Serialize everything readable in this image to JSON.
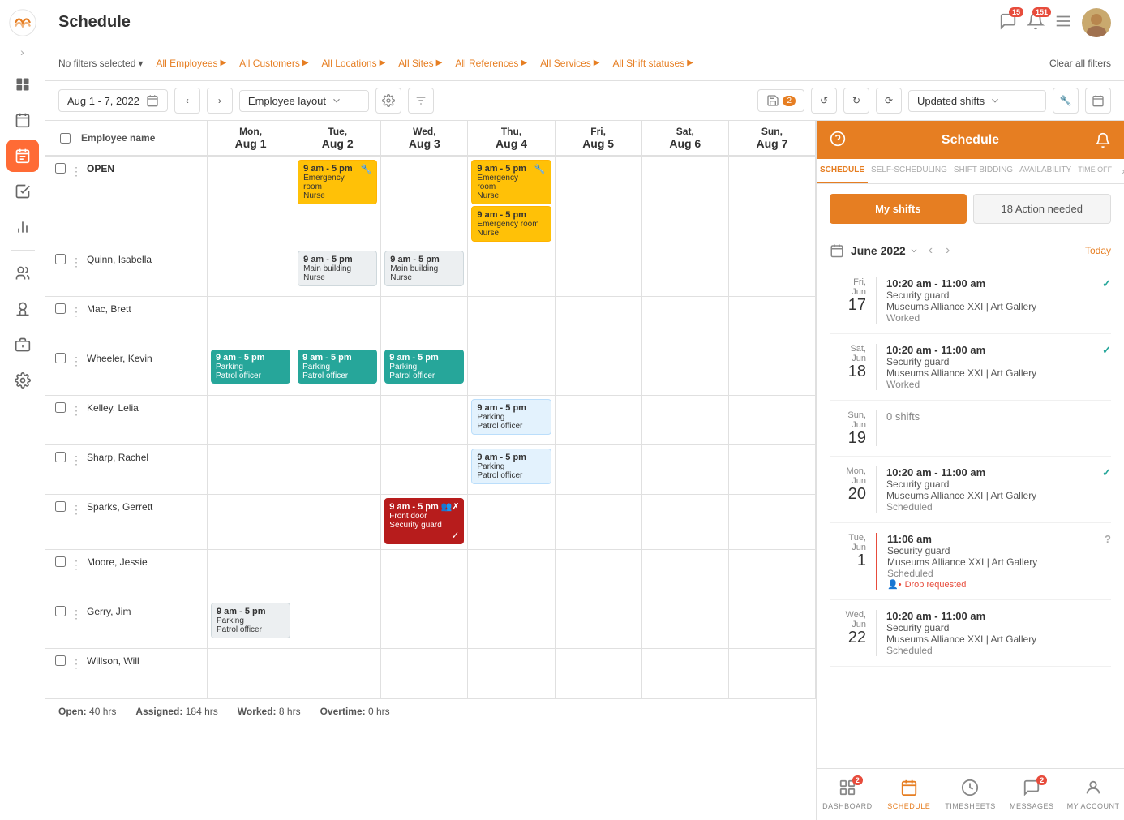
{
  "app": {
    "title": "Schedule",
    "logo_alt": "App Logo"
  },
  "topbar": {
    "notifications_count": "15",
    "alerts_count": "151",
    "menu_label": "Menu"
  },
  "filters": {
    "no_filters": "No filters selected",
    "employees": "All Employees",
    "customers": "All Customers",
    "locations": "All Locations",
    "sites": "All Sites",
    "references": "All References",
    "services": "All Services",
    "shift_statuses": "All Shift statuses",
    "clear": "Clear all filters"
  },
  "toolbar": {
    "date_range": "Aug 1 - 7, 2022",
    "layout": "Employee layout",
    "save_label": "2",
    "updated_shifts": "Updated shifts"
  },
  "calendar": {
    "columns": [
      {
        "day": "Mon",
        "date": "Aug 1"
      },
      {
        "day": "Tue",
        "date": "Aug 2"
      },
      {
        "day": "Wed",
        "date": "Aug 3"
      },
      {
        "day": "Thu",
        "date": "Aug 4"
      },
      {
        "day": "Fri",
        "date": "Aug 5"
      },
      {
        "day": "Sat",
        "date": "Aug 6"
      },
      {
        "day": "Sun",
        "date": "Aug 7"
      }
    ],
    "employee_col_header": "Employee name",
    "rows": [
      {
        "name": "OPEN",
        "is_open": true,
        "cells": [
          {
            "day": 0,
            "shifts": []
          },
          {
            "day": 1,
            "shifts": [
              {
                "time": "9 am - 5 pm",
                "location": "Emergency room",
                "role": "Nurse",
                "style": "yellow",
                "icon": "🔧"
              }
            ]
          },
          {
            "day": 2,
            "shifts": []
          },
          {
            "day": 3,
            "shifts": [
              {
                "time": "9 am - 5 pm",
                "location": "Emergency room",
                "role": "Nurse",
                "style": "yellow",
                "icon": "🔧"
              },
              {
                "time": "9 am - 5 pm",
                "location": "Emergency room",
                "role": "Nurse",
                "style": "yellow"
              }
            ]
          },
          {
            "day": 4,
            "shifts": []
          },
          {
            "day": 5,
            "shifts": []
          },
          {
            "day": 6,
            "shifts": []
          }
        ]
      },
      {
        "name": "Quinn, Isabella",
        "cells": [
          {
            "day": 0,
            "shifts": []
          },
          {
            "day": 1,
            "shifts": [
              {
                "time": "9 am - 5 pm",
                "location": "Main building",
                "role": "Nurse",
                "style": "gray"
              }
            ]
          },
          {
            "day": 2,
            "shifts": [
              {
                "time": "9 am - 5 pm",
                "location": "Main building",
                "role": "Nurse",
                "style": "gray"
              }
            ]
          },
          {
            "day": 3,
            "shifts": []
          },
          {
            "day": 4,
            "shifts": []
          },
          {
            "day": 5,
            "shifts": []
          },
          {
            "day": 6,
            "shifts": []
          }
        ]
      },
      {
        "name": "Mac, Brett",
        "cells": [
          {
            "day": 0,
            "shifts": []
          },
          {
            "day": 1,
            "shifts": []
          },
          {
            "day": 2,
            "shifts": []
          },
          {
            "day": 3,
            "shifts": []
          },
          {
            "day": 4,
            "shifts": []
          },
          {
            "day": 5,
            "shifts": []
          },
          {
            "day": 6,
            "shifts": []
          }
        ]
      },
      {
        "name": "Wheeler, Kevin",
        "cells": [
          {
            "day": 0,
            "shifts": [
              {
                "time": "9 am - 5 pm",
                "location": "Parking",
                "role": "Patrol officer",
                "style": "teal"
              }
            ]
          },
          {
            "day": 1,
            "shifts": [
              {
                "time": "9 am - 5 pm",
                "location": "Parking",
                "role": "Patrol officer",
                "style": "teal"
              }
            ]
          },
          {
            "day": 2,
            "shifts": [
              {
                "time": "9 am - 5 pm",
                "location": "Parking",
                "role": "Patrol officer",
                "style": "teal"
              }
            ]
          },
          {
            "day": 3,
            "shifts": []
          },
          {
            "day": 4,
            "shifts": []
          },
          {
            "day": 5,
            "shifts": []
          },
          {
            "day": 6,
            "shifts": []
          }
        ]
      },
      {
        "name": "Kelley, Lelia",
        "cells": [
          {
            "day": 0,
            "shifts": []
          },
          {
            "day": 1,
            "shifts": []
          },
          {
            "day": 2,
            "shifts": []
          },
          {
            "day": 3,
            "shifts": [
              {
                "time": "9 am - 5 pm",
                "location": "Parking",
                "role": "Patrol officer",
                "style": "blue-light"
              }
            ]
          },
          {
            "day": 4,
            "shifts": []
          },
          {
            "day": 5,
            "shifts": []
          },
          {
            "day": 6,
            "shifts": []
          }
        ]
      },
      {
        "name": "Sharp, Rachel",
        "cells": [
          {
            "day": 0,
            "shifts": []
          },
          {
            "day": 1,
            "shifts": []
          },
          {
            "day": 2,
            "shifts": []
          },
          {
            "day": 3,
            "shifts": [
              {
                "time": "9 am - 5 pm",
                "location": "Parking",
                "role": "Patrol officer",
                "style": "blue-light"
              }
            ]
          },
          {
            "day": 4,
            "shifts": []
          },
          {
            "day": 5,
            "shifts": []
          },
          {
            "day": 6,
            "shifts": []
          }
        ]
      },
      {
        "name": "Sparks, Gerrett",
        "cells": [
          {
            "day": 0,
            "shifts": []
          },
          {
            "day": 1,
            "shifts": []
          },
          {
            "day": 2,
            "shifts": [
              {
                "time": "9 am - 5 pm",
                "location": "Front door",
                "role": "Security guard",
                "style": "red",
                "icon": "👥✗",
                "check": true
              }
            ]
          },
          {
            "day": 3,
            "shifts": []
          },
          {
            "day": 4,
            "shifts": []
          },
          {
            "day": 5,
            "shifts": []
          },
          {
            "day": 6,
            "shifts": []
          }
        ]
      },
      {
        "name": "Moore, Jessie",
        "cells": [
          {
            "day": 0,
            "shifts": []
          },
          {
            "day": 1,
            "shifts": []
          },
          {
            "day": 2,
            "shifts": []
          },
          {
            "day": 3,
            "shifts": []
          },
          {
            "day": 4,
            "shifts": []
          },
          {
            "day": 5,
            "shifts": []
          },
          {
            "day": 6,
            "shifts": []
          }
        ]
      },
      {
        "name": "Gerry, Jim",
        "cells": [
          {
            "day": 0,
            "shifts": [
              {
                "time": "9 am - 5 pm",
                "location": "Parking",
                "role": "Patrol officer",
                "style": "gray"
              }
            ]
          },
          {
            "day": 1,
            "shifts": []
          },
          {
            "day": 2,
            "shifts": []
          },
          {
            "day": 3,
            "shifts": []
          },
          {
            "day": 4,
            "shifts": []
          },
          {
            "day": 5,
            "shifts": []
          },
          {
            "day": 6,
            "shifts": []
          }
        ]
      },
      {
        "name": "Willson, Will",
        "cells": [
          {
            "day": 0,
            "shifts": []
          },
          {
            "day": 1,
            "shifts": []
          },
          {
            "day": 2,
            "shifts": []
          },
          {
            "day": 3,
            "shifts": []
          },
          {
            "day": 4,
            "shifts": []
          },
          {
            "day": 5,
            "shifts": []
          },
          {
            "day": 6,
            "shifts": []
          }
        ]
      }
    ]
  },
  "footer": {
    "open_label": "Open:",
    "open_value": "40 hrs",
    "assigned_label": "Assigned:",
    "assigned_value": "184 hrs",
    "worked_label": "Worked:",
    "worked_value": "8 hrs",
    "overtime_label": "Overtime:",
    "overtime_value": "0 hrs"
  },
  "right_panel": {
    "title": "Schedule",
    "tabs": [
      "SCHEDULE",
      "SELF-SCHEDULING",
      "SHIFT BIDDING",
      "AVAILABILITY",
      "TIME OFF"
    ],
    "my_shifts_btn": "My shifts",
    "action_needed_btn": "18 Action needed",
    "month": "June 2022",
    "today_btn": "Today",
    "shifts": [
      {
        "day_abbr": "Fri,",
        "month_abbr": "Jun",
        "day_num": "17",
        "time": "10:20 am - 11:00 am",
        "role": "Security guard",
        "location": "Museums Alliance XXI | Art Gallery",
        "status": "Worked",
        "check": true,
        "help": false,
        "drop": false,
        "red_border": false
      },
      {
        "day_abbr": "Sat,",
        "month_abbr": "Jun",
        "day_num": "18",
        "time": "10:20 am - 11:00 am",
        "role": "Security guard",
        "location": "Museums Alliance XXI | Art Gallery",
        "status": "Worked",
        "check": true,
        "help": false,
        "drop": false,
        "red_border": false
      },
      {
        "day_abbr": "Sun,",
        "month_abbr": "Jun",
        "day_num": "19",
        "time": "",
        "role": "",
        "location": "",
        "status": "0 shifts",
        "zero": true,
        "check": false,
        "help": false,
        "drop": false,
        "red_border": false
      },
      {
        "day_abbr": "Mon,",
        "month_abbr": "Jun",
        "day_num": "20",
        "time": "10:20 am - 11:00 am",
        "role": "Security guard",
        "location": "Museums Alliance XXI | Art Gallery",
        "status": "Scheduled",
        "check": true,
        "help": false,
        "drop": false,
        "red_border": false
      },
      {
        "day_abbr": "Tue,",
        "month_abbr": "Jun",
        "day_num": "1",
        "time": "11:06 am",
        "role": "Security guard",
        "location": "Museums Alliance XXI | Art Gallery",
        "status": "Scheduled",
        "drop_text": "Drop requested",
        "check": false,
        "help": true,
        "drop": true,
        "red_border": true
      },
      {
        "day_abbr": "Wed,",
        "month_abbr": "Jun",
        "day_num": "22",
        "time": "10:20 am - 11:00 am",
        "role": "Security guard",
        "location": "Museums Alliance XXI | Art Gallery",
        "status": "Scheduled",
        "check": false,
        "help": false,
        "drop": false,
        "red_border": false
      }
    ],
    "bottom_nav": [
      {
        "label": "DASHBOARD",
        "icon": "dashboard",
        "badge": "2"
      },
      {
        "label": "SCHEDULE",
        "icon": "schedule",
        "active": true,
        "badge": null
      },
      {
        "label": "TIMESHEETS",
        "icon": "timesheets",
        "badge": null
      },
      {
        "label": "MESSAGES",
        "icon": "messages",
        "badge": "2"
      },
      {
        "label": "MY ACCOUNT",
        "icon": "account",
        "badge": null
      }
    ]
  }
}
